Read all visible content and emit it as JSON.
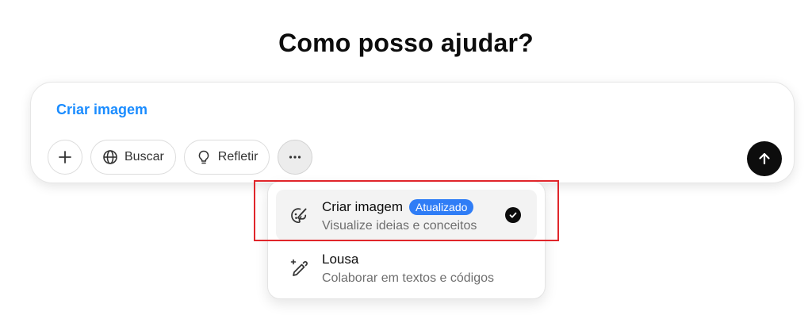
{
  "header": {
    "title": "Como posso ajudar?"
  },
  "composer": {
    "active_mode": "Criar imagem",
    "tools": {
      "search_label": "Buscar",
      "reason_label": "Refletir"
    }
  },
  "menu": {
    "items": [
      {
        "title": "Criar imagem",
        "badge": "Atualizado",
        "subtitle": "Visualize ideias e conceitos",
        "icon": "palette-icon",
        "selected": true
      },
      {
        "title": "Lousa",
        "subtitle": "Colaborar em textos e códigos",
        "icon": "pencil-sparkle-icon",
        "selected": false
      }
    ]
  },
  "colors": {
    "accent": "#1a8cff",
    "badge": "#2f7df6",
    "highlight": "#e0262b",
    "send_button": "#0d0d0d"
  }
}
